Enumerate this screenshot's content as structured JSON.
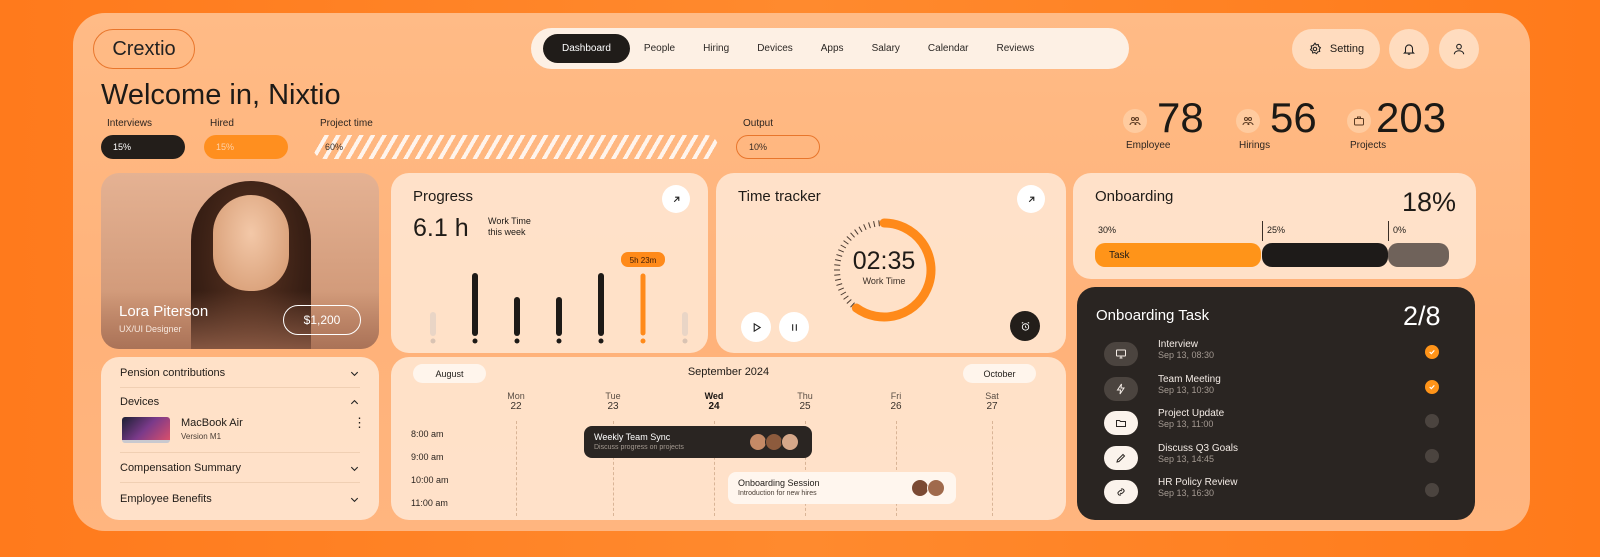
{
  "brand": {
    "logo": "Crextio"
  },
  "nav": {
    "items": [
      "Dashboard",
      "People",
      "Hiring",
      "Devices",
      "Apps",
      "Salary",
      "Calendar",
      "Reviews"
    ],
    "active": "Dashboard"
  },
  "header": {
    "setting_label": "Setting",
    "welcome": "Welcome in, Nixtio"
  },
  "metrics": {
    "interviews": {
      "label": "Interviews",
      "value": "15%"
    },
    "hired": {
      "label": "Hired",
      "value": "15%"
    },
    "project_time": {
      "label": "Project time",
      "value": "60%"
    },
    "output": {
      "label": "Output",
      "value": "10%"
    }
  },
  "stats": [
    {
      "value": "78",
      "label": "Employee",
      "icon": "people-icon"
    },
    {
      "value": "56",
      "label": "Hirings",
      "icon": "people-icon"
    },
    {
      "value": "203",
      "label": "Projects",
      "icon": "briefcase-icon"
    }
  ],
  "profile": {
    "name": "Lora Piterson",
    "role": "UX/UI Designer",
    "salary": "$1,200"
  },
  "progress": {
    "title": "Progress",
    "hours": "6.1 h",
    "subtitle_line1": "Work Time",
    "subtitle_line2": "this week",
    "highlight": "5h 23m",
    "days": [
      "S",
      "M",
      "T",
      "W",
      "T",
      "F",
      "S"
    ]
  },
  "chart_data": {
    "type": "bar",
    "categories": [
      "S",
      "M",
      "T",
      "W",
      "T",
      "F",
      "S"
    ],
    "values": [
      0.3,
      0.95,
      0.55,
      0.55,
      0.95,
      0.95,
      0.3
    ],
    "highlight_index": 5,
    "title": "Progress"
  },
  "tracker": {
    "title": "Time tracker",
    "time": "02:35",
    "label": "Work Time",
    "progress": 0.6
  },
  "onboarding": {
    "title": "Onboarding",
    "percent": "18%",
    "segments": [
      {
        "label": "30%",
        "bar": "Task",
        "color": "#ff9419"
      },
      {
        "label": "25%",
        "bar": "",
        "color": "#1e1b19"
      },
      {
        "label": "0%",
        "bar": "",
        "color": "#6f625a"
      }
    ]
  },
  "tasks": {
    "title": "Onboarding Task",
    "count": "2/8",
    "items": [
      {
        "name": "Interview",
        "date": "Sep 13, 08:30",
        "done": true,
        "icon": "monitor-icon"
      },
      {
        "name": "Team Meeting",
        "date": "Sep 13, 10:30",
        "done": true,
        "icon": "bolt-icon"
      },
      {
        "name": "Project Update",
        "date": "Sep 13, 11:00",
        "done": false,
        "icon": "folder-icon"
      },
      {
        "name": "Discuss Q3 Goals",
        "date": "Sep 13, 14:45",
        "done": false,
        "icon": "pencil-icon"
      },
      {
        "name": "HR Policy Review",
        "date": "Sep 13, 16:30",
        "done": false,
        "icon": "link-icon"
      }
    ]
  },
  "accordion": {
    "pension": "Pension contributions",
    "devices": "Devices",
    "device_name": "MacBook Air",
    "device_version": "Version M1",
    "compensation": "Compensation Summary",
    "benefits": "Employee Benefits"
  },
  "calendar": {
    "prev": "August",
    "month": "September 2024",
    "next": "October",
    "days": [
      {
        "d": "Mon",
        "n": "22"
      },
      {
        "d": "Tue",
        "n": "23"
      },
      {
        "d": "Wed",
        "n": "24"
      },
      {
        "d": "Thu",
        "n": "25"
      },
      {
        "d": "Fri",
        "n": "26"
      },
      {
        "d": "Sat",
        "n": "27"
      }
    ],
    "times": [
      "8:00 am",
      "9:00 am",
      "10:00 am",
      "11:00 am"
    ],
    "events": [
      {
        "title": "Weekly Team Sync",
        "desc": "Discuss progress on projects"
      },
      {
        "title": "Onboarding Session",
        "desc": "Introduction for new hires"
      }
    ]
  }
}
